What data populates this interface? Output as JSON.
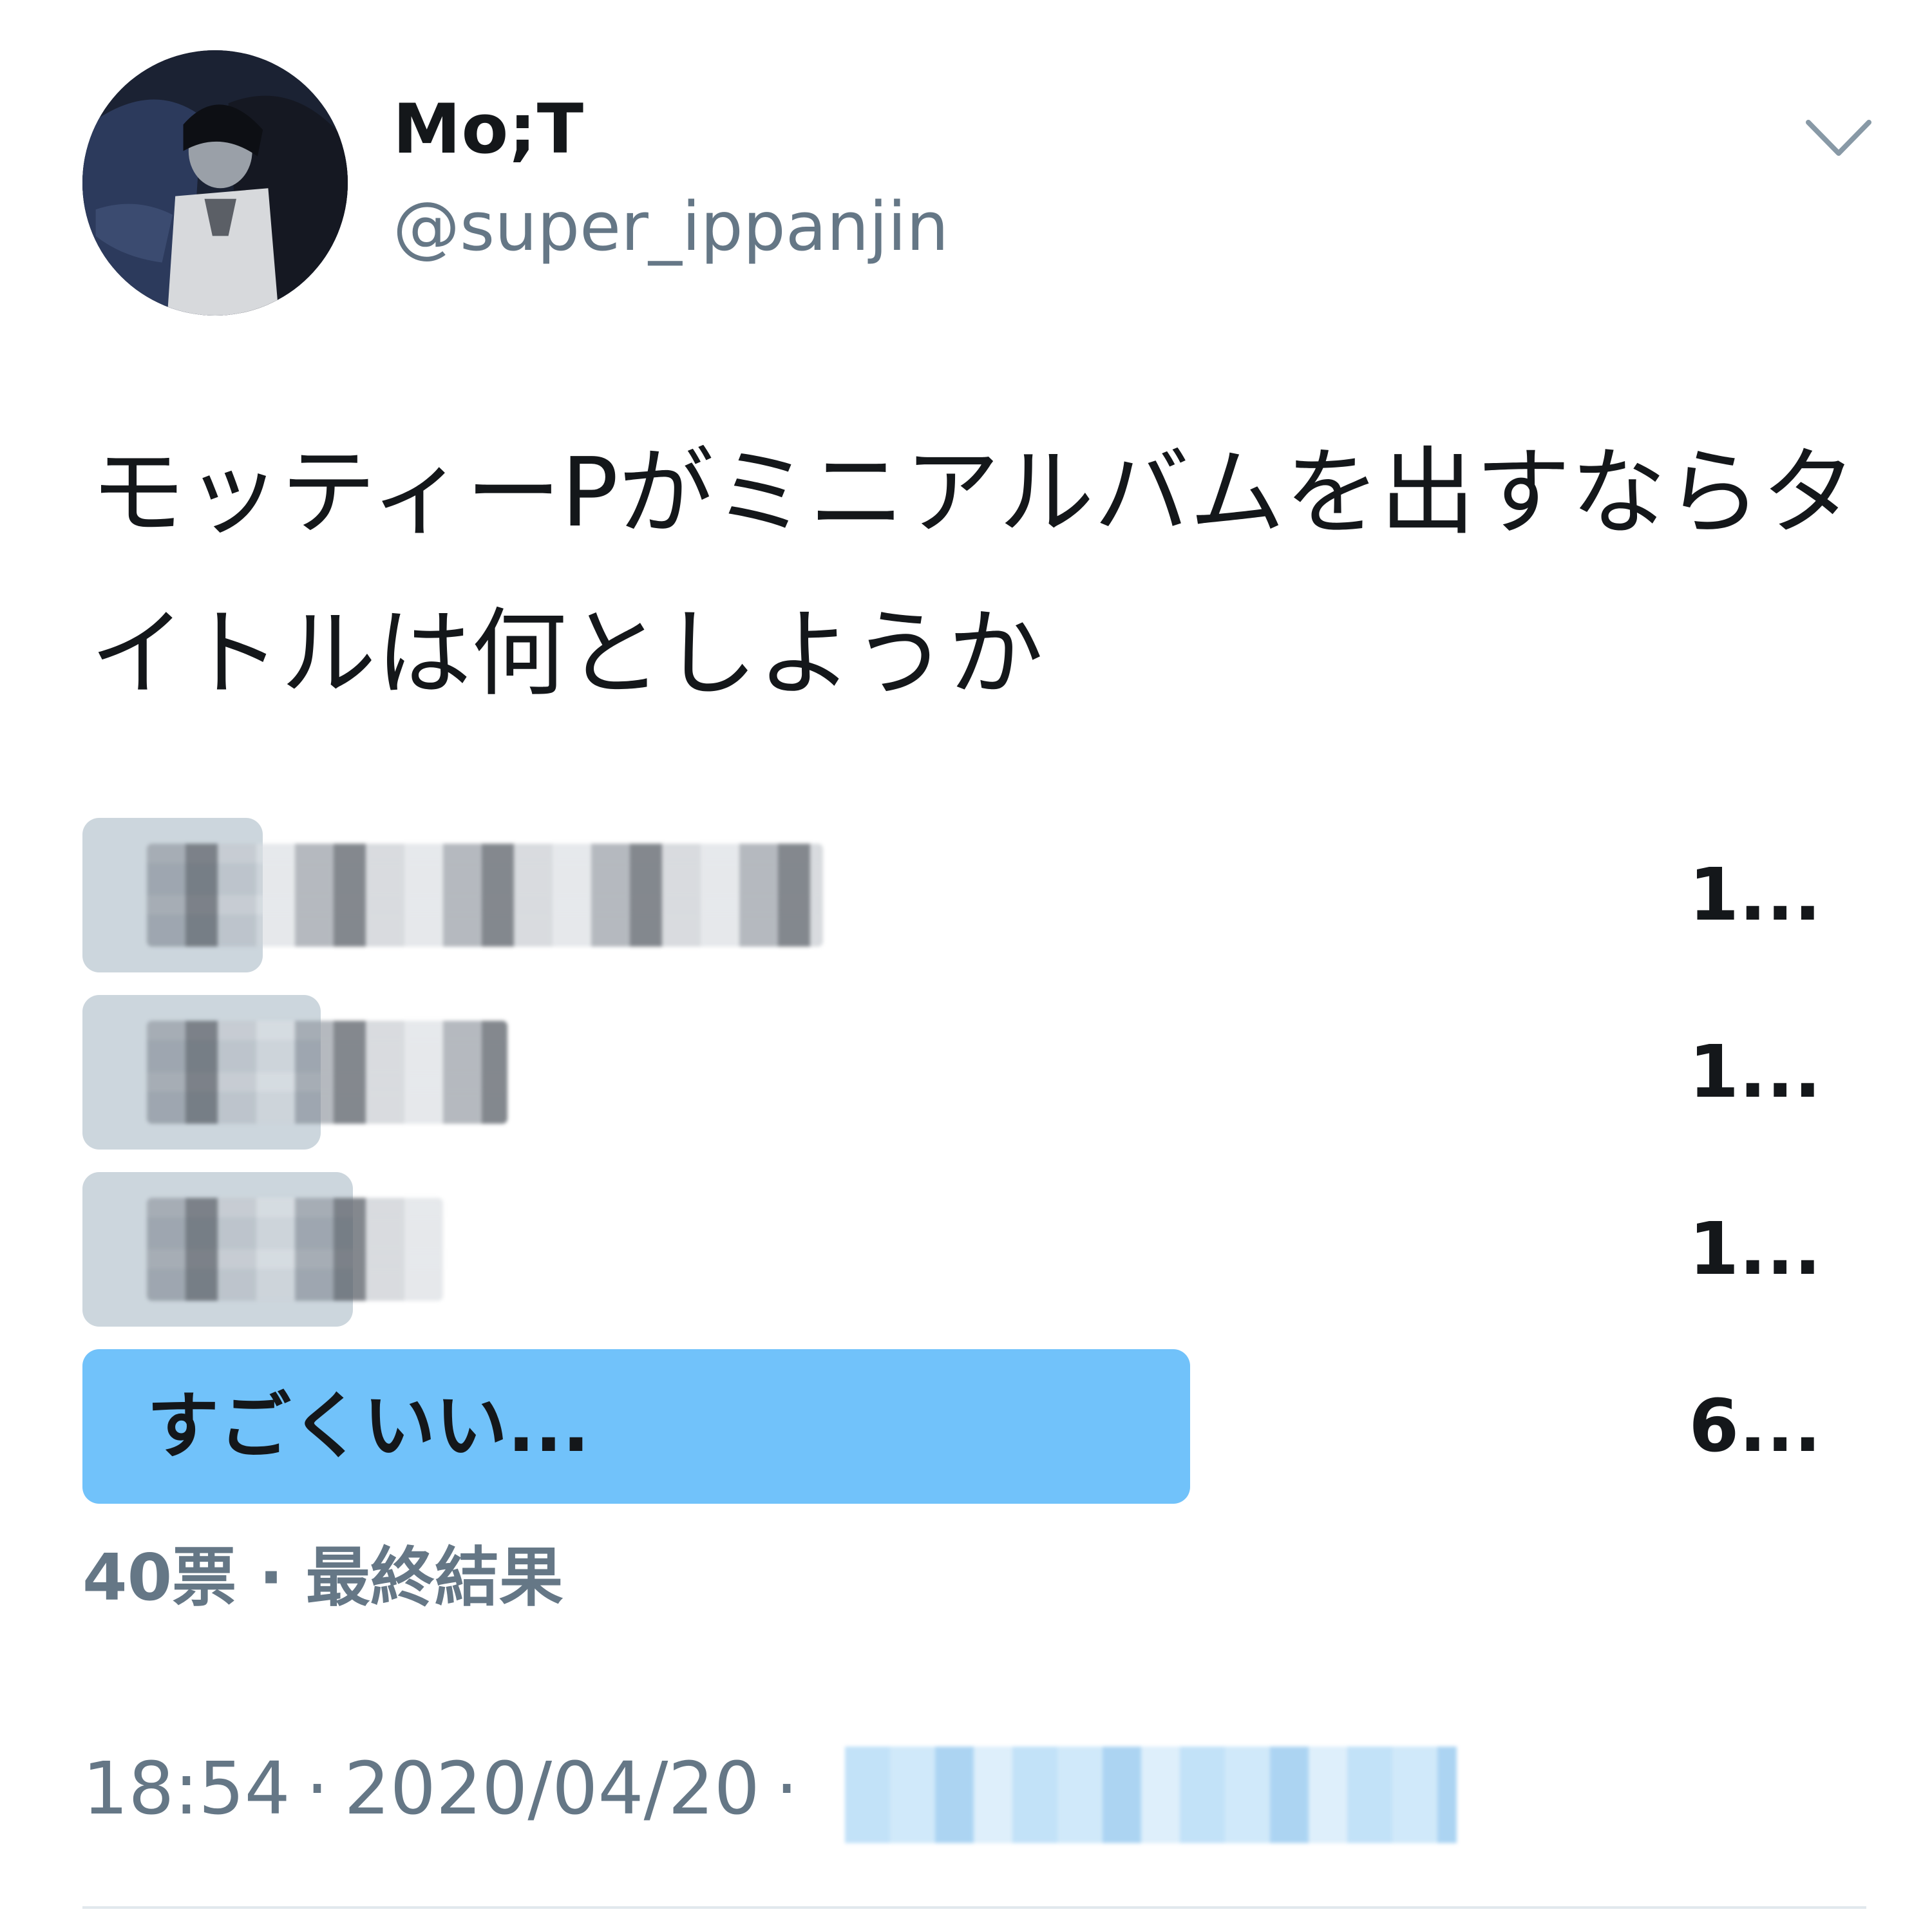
{
  "user": {
    "display_name": "Mo;T",
    "handle": "@super_ippanjin"
  },
  "tweet": {
    "text": "モッティーPがミニアルバムを出すならタイトルは何としようか"
  },
  "poll": {
    "options": [
      {
        "label": "",
        "percent_text": "1..."
      },
      {
        "label": "",
        "percent_text": "1..."
      },
      {
        "label": "",
        "percent_text": "1..."
      },
      {
        "label": "すごくいい...",
        "percent_text": "6..."
      }
    ],
    "summary": "40票 · 最終結果"
  },
  "meta": {
    "time": "18:54",
    "date": "2020/04/20",
    "separator": "·"
  },
  "colors": {
    "winner_bar": "#71c2fa",
    "other_bar": "#ccd6dd",
    "secondary_text": "#657786"
  },
  "icons": {
    "menu": "chevron-down-icon"
  }
}
